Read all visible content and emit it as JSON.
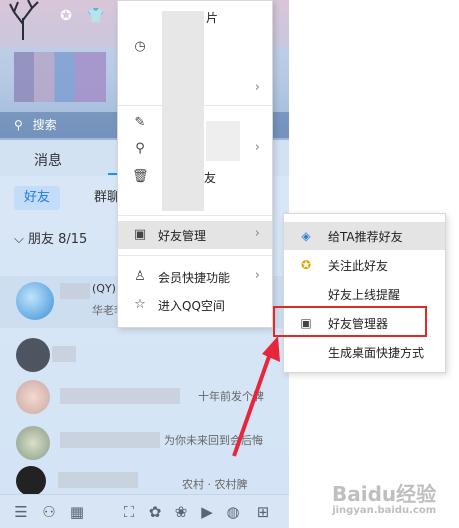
{
  "header": {
    "header_title_fragment": "片",
    "search_placeholder": "搜索"
  },
  "tabs": {
    "messages": "消息"
  },
  "subtabs": {
    "friends": "好友",
    "groups": "群聊"
  },
  "friend_group": {
    "label": "朋友 8/15"
  },
  "contacts": [
    {
      "text": "(QY)",
      "subtext": "华老李"
    },
    {
      "text": "",
      "subtext": ""
    },
    {
      "text": "",
      "subtext": "十年前发个脾"
    },
    {
      "text": "",
      "subtext": "为你未来回到会后悔"
    },
    {
      "text": "",
      "subtext": "农村  ·  农村脾"
    }
  ],
  "context_menu": {
    "items": [
      {
        "label": "",
        "icon": "clock-icon"
      },
      {
        "label": "",
        "icon": "blank-icon"
      },
      {
        "label": "",
        "icon": "edit-icon"
      },
      {
        "label": "",
        "icon": "user-icon"
      },
      {
        "label": "友",
        "icon": "delete-icon"
      },
      {
        "label": "好友管理",
        "icon": "contact-card-icon",
        "has_submenu": true,
        "highlighted": true
      },
      {
        "label": "会员快捷功能",
        "icon": "penguin-icon",
        "has_submenu": true
      },
      {
        "label": "进入QQ空间",
        "icon": "star-icon"
      }
    ]
  },
  "submenu": {
    "items": [
      {
        "label": "给TA推荐好友",
        "icon": "recommend-friend-icon",
        "highlighted": true
      },
      {
        "label": "关注此好友",
        "icon": "follow-icon"
      },
      {
        "label": "好友上线提醒",
        "icon": ""
      },
      {
        "label": "好友管理器",
        "icon": "contact-card-icon",
        "boxed": true
      },
      {
        "label": "生成桌面快捷方式",
        "icon": ""
      }
    ]
  },
  "watermark": {
    "text": "Baidu经验",
    "sub": "jingyan.baidu.com"
  },
  "colors": {
    "accent": "#1f7be0",
    "highlight_box": "#e02a2a",
    "arrow": "#e8263b"
  }
}
